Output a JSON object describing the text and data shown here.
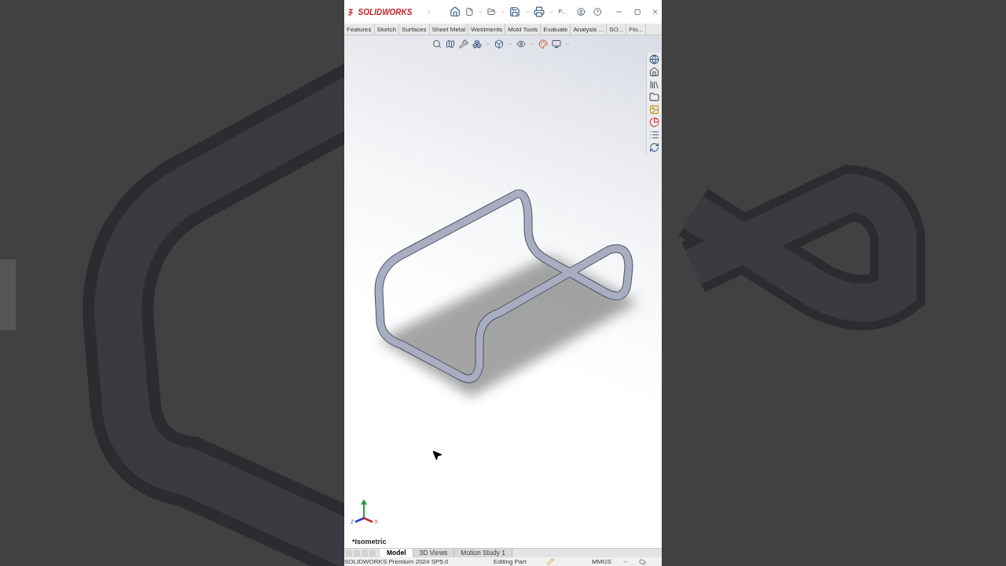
{
  "window": {
    "logo_text": "SOLIDWORKS",
    "quick_access_overflow": "P..."
  },
  "command_tabs": [
    {
      "label": "Features"
    },
    {
      "label": "Sketch"
    },
    {
      "label": "Surfaces"
    },
    {
      "label": "Sheet Metal"
    },
    {
      "label": "Weldments"
    },
    {
      "label": "Mold Tools"
    },
    {
      "label": "Evaluate"
    },
    {
      "label": "Analysis ..."
    },
    {
      "label": "SO..."
    },
    {
      "label": "Flo..."
    }
  ],
  "viewport": {
    "axis_labels": [
      "Z",
      "X"
    ],
    "view_name": "*Isometric"
  },
  "bottom_tabs": [
    {
      "label": "Model",
      "selected": true
    },
    {
      "label": "3D Views",
      "selected": false
    },
    {
      "label": "Motion Study 1",
      "selected": false
    }
  ],
  "status_bar": {
    "product": "SOLIDWORKS Premium 2024 SP5.0",
    "mode": "Editing Part",
    "units": "MMGS"
  }
}
